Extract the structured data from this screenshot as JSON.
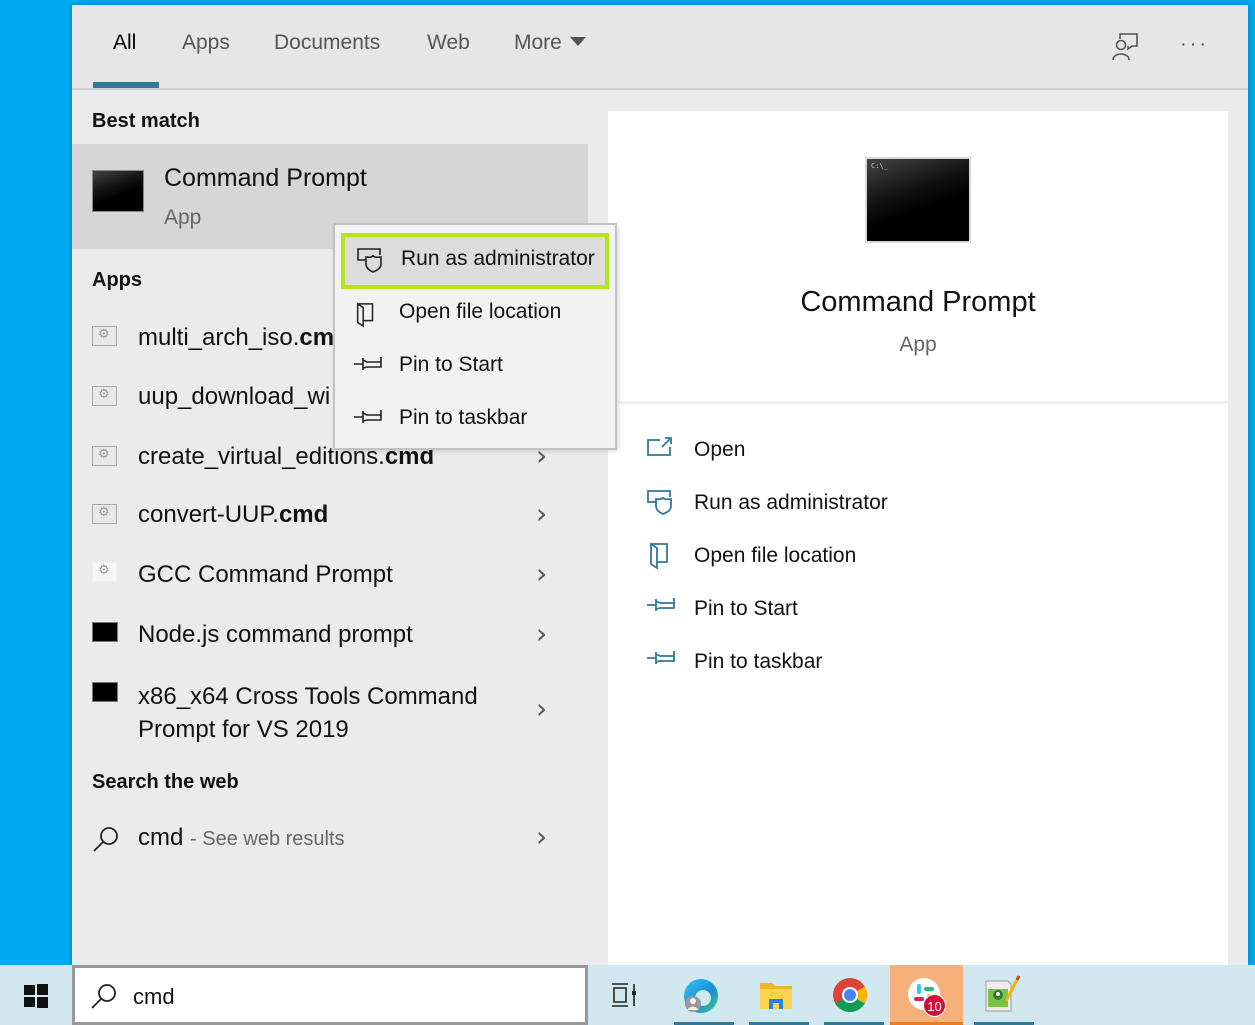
{
  "tabs": {
    "items": [
      {
        "label": "All",
        "active": true
      },
      {
        "label": "Apps"
      },
      {
        "label": "Documents"
      },
      {
        "label": "Web"
      },
      {
        "label": "More"
      }
    ],
    "feedback_icon": "feedback-person-icon",
    "more_options_icon": "ellipsis-icon",
    "more_options_label": "···"
  },
  "left": {
    "best_match_heading": "Best match",
    "best_match": {
      "title": "Command Prompt",
      "subtitle": "App",
      "icon": "command-prompt-icon"
    },
    "apps_heading": "Apps",
    "apps": [
      {
        "name": "multi_arch_iso.",
        "ext": "cmd",
        "icon": "batch-file-icon"
      },
      {
        "name": "uup_download_wi",
        "ext": "",
        "icon": "batch-file-icon"
      },
      {
        "name": "create_virtual_editions.",
        "ext": "cmd",
        "icon": "batch-file-icon"
      },
      {
        "name": "convert-UUP.",
        "ext": "cmd",
        "icon": "batch-file-icon"
      },
      {
        "name": "GCC Command Prompt",
        "ext": "",
        "icon": "batch-file-icon"
      },
      {
        "name": "Node.js command prompt",
        "ext": "",
        "icon": "console-icon"
      },
      {
        "name": "x86_x64 Cross Tools Command",
        "name_line2": "Prompt for VS 2019",
        "ext": "",
        "icon": "console-icon"
      }
    ],
    "web_heading": "Search the web",
    "web_result": {
      "query": "cmd",
      "suffix": "- See web results"
    }
  },
  "context_menu": {
    "items": [
      {
        "label": "Run as administrator",
        "icon": "shield-admin-icon",
        "highlighted": true
      },
      {
        "label": "Open file location",
        "icon": "file-location-icon"
      },
      {
        "label": "Pin to Start",
        "icon": "pin-icon"
      },
      {
        "label": "Pin to taskbar",
        "icon": "pin-icon"
      }
    ],
    "highlight_color": "#b5e61d"
  },
  "preview": {
    "title": "Command Prompt",
    "subtitle": "App",
    "icon_caption": "C:\\_",
    "actions": [
      {
        "label": "Open",
        "icon": "open-icon"
      },
      {
        "label": "Run as administrator",
        "icon": "shield-admin-icon"
      },
      {
        "label": "Open file location",
        "icon": "file-location-icon"
      },
      {
        "label": "Pin to Start",
        "icon": "pin-icon"
      },
      {
        "label": "Pin to taskbar",
        "icon": "pin-icon"
      }
    ],
    "accent": "#2e7a98"
  },
  "taskbar": {
    "search_value": "cmd",
    "apps": [
      {
        "name": "Task View",
        "icon": "task-view-icon"
      },
      {
        "name": "Microsoft Edge",
        "icon": "edge-icon"
      },
      {
        "name": "File Explorer",
        "icon": "folder-icon"
      },
      {
        "name": "Google Chrome",
        "icon": "chrome-icon"
      },
      {
        "name": "Slack",
        "icon": "slack-icon",
        "badge": "10"
      },
      {
        "name": "Notepad++",
        "icon": "notepad-plus-plus-icon"
      }
    ]
  }
}
